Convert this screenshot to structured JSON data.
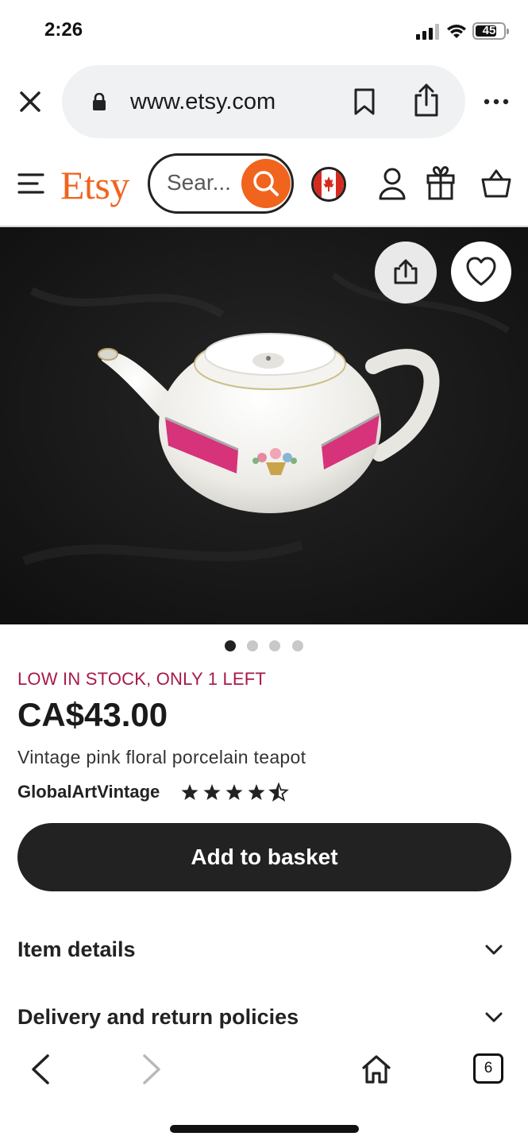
{
  "status_bar": {
    "time": "2:26",
    "battery": "45"
  },
  "browser": {
    "url": "www.etsy.com",
    "tab_count": "6"
  },
  "header": {
    "logo": "Etsy",
    "search_placeholder": "Sear..."
  },
  "product": {
    "stock_notice": "LOW IN STOCK, ONLY 1 LEFT",
    "price": "CA$43.00",
    "title": "Vintage pink floral porcelain teapot",
    "shop_name": "GlobalArtVintage",
    "rating_stars": 4.5,
    "image_count": 4,
    "current_image": 1
  },
  "actions": {
    "add_to_basket": "Add to basket"
  },
  "accordions": [
    {
      "label": "Item details"
    },
    {
      "label": "Delivery and return policies"
    }
  ],
  "colors": {
    "brand": "#f1641e",
    "stock_alert": "#a61a4b",
    "primary_button": "#222222"
  }
}
